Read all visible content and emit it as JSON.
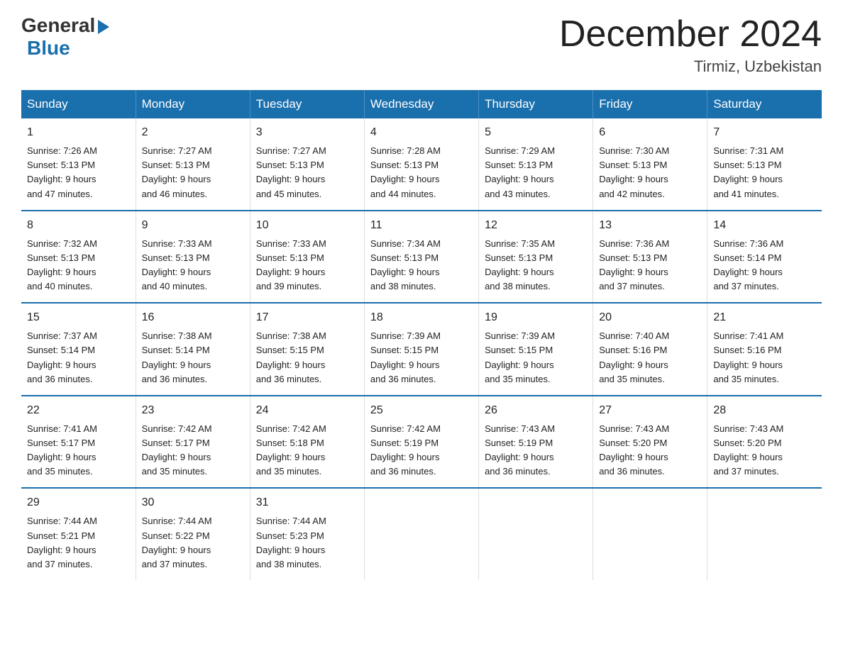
{
  "logo": {
    "general": "General",
    "blue": "Blue"
  },
  "title": "December 2024",
  "subtitle": "Tirmiz, Uzbekistan",
  "days_of_week": [
    "Sunday",
    "Monday",
    "Tuesday",
    "Wednesday",
    "Thursday",
    "Friday",
    "Saturday"
  ],
  "weeks": [
    [
      {
        "num": "1",
        "sunrise": "7:26 AM",
        "sunset": "5:13 PM",
        "daylight": "9 hours and 47 minutes."
      },
      {
        "num": "2",
        "sunrise": "7:27 AM",
        "sunset": "5:13 PM",
        "daylight": "9 hours and 46 minutes."
      },
      {
        "num": "3",
        "sunrise": "7:27 AM",
        "sunset": "5:13 PM",
        "daylight": "9 hours and 45 minutes."
      },
      {
        "num": "4",
        "sunrise": "7:28 AM",
        "sunset": "5:13 PM",
        "daylight": "9 hours and 44 minutes."
      },
      {
        "num": "5",
        "sunrise": "7:29 AM",
        "sunset": "5:13 PM",
        "daylight": "9 hours and 43 minutes."
      },
      {
        "num": "6",
        "sunrise": "7:30 AM",
        "sunset": "5:13 PM",
        "daylight": "9 hours and 42 minutes."
      },
      {
        "num": "7",
        "sunrise": "7:31 AM",
        "sunset": "5:13 PM",
        "daylight": "9 hours and 41 minutes."
      }
    ],
    [
      {
        "num": "8",
        "sunrise": "7:32 AM",
        "sunset": "5:13 PM",
        "daylight": "9 hours and 40 minutes."
      },
      {
        "num": "9",
        "sunrise": "7:33 AM",
        "sunset": "5:13 PM",
        "daylight": "9 hours and 40 minutes."
      },
      {
        "num": "10",
        "sunrise": "7:33 AM",
        "sunset": "5:13 PM",
        "daylight": "9 hours and 39 minutes."
      },
      {
        "num": "11",
        "sunrise": "7:34 AM",
        "sunset": "5:13 PM",
        "daylight": "9 hours and 38 minutes."
      },
      {
        "num": "12",
        "sunrise": "7:35 AM",
        "sunset": "5:13 PM",
        "daylight": "9 hours and 38 minutes."
      },
      {
        "num": "13",
        "sunrise": "7:36 AM",
        "sunset": "5:13 PM",
        "daylight": "9 hours and 37 minutes."
      },
      {
        "num": "14",
        "sunrise": "7:36 AM",
        "sunset": "5:14 PM",
        "daylight": "9 hours and 37 minutes."
      }
    ],
    [
      {
        "num": "15",
        "sunrise": "7:37 AM",
        "sunset": "5:14 PM",
        "daylight": "9 hours and 36 minutes."
      },
      {
        "num": "16",
        "sunrise": "7:38 AM",
        "sunset": "5:14 PM",
        "daylight": "9 hours and 36 minutes."
      },
      {
        "num": "17",
        "sunrise": "7:38 AM",
        "sunset": "5:15 PM",
        "daylight": "9 hours and 36 minutes."
      },
      {
        "num": "18",
        "sunrise": "7:39 AM",
        "sunset": "5:15 PM",
        "daylight": "9 hours and 36 minutes."
      },
      {
        "num": "19",
        "sunrise": "7:39 AM",
        "sunset": "5:15 PM",
        "daylight": "9 hours and 35 minutes."
      },
      {
        "num": "20",
        "sunrise": "7:40 AM",
        "sunset": "5:16 PM",
        "daylight": "9 hours and 35 minutes."
      },
      {
        "num": "21",
        "sunrise": "7:41 AM",
        "sunset": "5:16 PM",
        "daylight": "9 hours and 35 minutes."
      }
    ],
    [
      {
        "num": "22",
        "sunrise": "7:41 AM",
        "sunset": "5:17 PM",
        "daylight": "9 hours and 35 minutes."
      },
      {
        "num": "23",
        "sunrise": "7:42 AM",
        "sunset": "5:17 PM",
        "daylight": "9 hours and 35 minutes."
      },
      {
        "num": "24",
        "sunrise": "7:42 AM",
        "sunset": "5:18 PM",
        "daylight": "9 hours and 35 minutes."
      },
      {
        "num": "25",
        "sunrise": "7:42 AM",
        "sunset": "5:19 PM",
        "daylight": "9 hours and 36 minutes."
      },
      {
        "num": "26",
        "sunrise": "7:43 AM",
        "sunset": "5:19 PM",
        "daylight": "9 hours and 36 minutes."
      },
      {
        "num": "27",
        "sunrise": "7:43 AM",
        "sunset": "5:20 PM",
        "daylight": "9 hours and 36 minutes."
      },
      {
        "num": "28",
        "sunrise": "7:43 AM",
        "sunset": "5:20 PM",
        "daylight": "9 hours and 37 minutes."
      }
    ],
    [
      {
        "num": "29",
        "sunrise": "7:44 AM",
        "sunset": "5:21 PM",
        "daylight": "9 hours and 37 minutes."
      },
      {
        "num": "30",
        "sunrise": "7:44 AM",
        "sunset": "5:22 PM",
        "daylight": "9 hours and 37 minutes."
      },
      {
        "num": "31",
        "sunrise": "7:44 AM",
        "sunset": "5:23 PM",
        "daylight": "9 hours and 38 minutes."
      },
      null,
      null,
      null,
      null
    ]
  ],
  "labels": {
    "sunrise": "Sunrise:",
    "sunset": "Sunset:",
    "daylight": "Daylight:"
  }
}
